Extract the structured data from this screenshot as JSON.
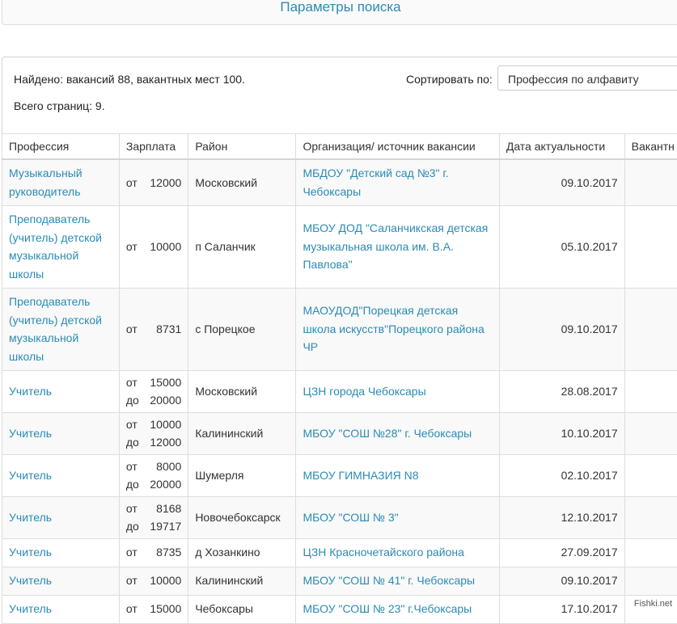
{
  "search_panel": {
    "title": "Параметры поиска"
  },
  "summary": {
    "found": "Найдено: вакансий 88, вакантных мест 100.",
    "pages": "Всего страниц: 9."
  },
  "sort": {
    "label": "Сортировать по:",
    "value": "Профессия по алфавиту"
  },
  "table": {
    "headers": [
      "Профессия",
      "Зарплата",
      "Район",
      "Организация/ источник вакансии",
      "Дата актуальности",
      "Вакантн"
    ],
    "rows": [
      {
        "profession": "Музыкальный руководитель",
        "sal_from": "12000",
        "sal_to": "",
        "district": "Московский",
        "org": "МБДОУ \"Детский сад №3\" г. Чебоксары",
        "date": "09.10.2017"
      },
      {
        "profession": "Преподаватель (учитель) детской музыкальной школы",
        "sal_from": "10000",
        "sal_to": "",
        "district": "п Саланчик",
        "org": "МБОУ ДОД \"Саланчикская детская музыкальная школа им. В.А. Павлова\"",
        "date": "05.10.2017"
      },
      {
        "profession": "Преподаватель (учитель) детской музыкальной школы",
        "sal_from": "8731",
        "sal_to": "",
        "district": "с Порецкое",
        "org": "МАОУДОД\"Порецкая детская школа искусств\"Порецкого района ЧР",
        "date": "09.10.2017"
      },
      {
        "profession": "Учитель",
        "sal_from": "15000",
        "sal_to": "20000",
        "district": "Московский",
        "org": "ЦЗН города Чебоксары",
        "date": "28.08.2017"
      },
      {
        "profession": "Учитель",
        "sal_from": "10000",
        "sal_to": "12000",
        "district": "Калининский",
        "org": "МБОУ \"СОШ №28\" г. Чебоксары",
        "date": "10.10.2017"
      },
      {
        "profession": "Учитель",
        "sal_from": "8000",
        "sal_to": "20000",
        "district": "Шумерля",
        "org": "МБОУ ГИМНАЗИЯ N8",
        "date": "02.10.2017"
      },
      {
        "profession": "Учитель",
        "sal_from": "8168",
        "sal_to": "19717",
        "district": "Новочебоксарск",
        "org": "МБОУ \"СОШ № 3\"",
        "date": "12.10.2017"
      },
      {
        "profession": "Учитель",
        "sal_from": "8735",
        "sal_to": "",
        "district": "д Хозанкино",
        "org": "ЦЗН Красночетайского района",
        "date": "27.09.2017"
      },
      {
        "profession": "Учитель",
        "sal_from": "10000",
        "sal_to": "",
        "district": "Калининский",
        "org": "МБОУ \"СОШ № 41\" г. Чебоксары",
        "date": "09.10.2017"
      },
      {
        "profession": "Учитель",
        "sal_from": "15000",
        "sal_to": "",
        "district": "Чебоксары",
        "org": "МБОУ \"СОШ № 23\" г.Чебоксары",
        "date": "17.10.2017"
      }
    ],
    "sal_from_label": "от",
    "sal_to_label": "до"
  },
  "watermark": "Fishki.net"
}
